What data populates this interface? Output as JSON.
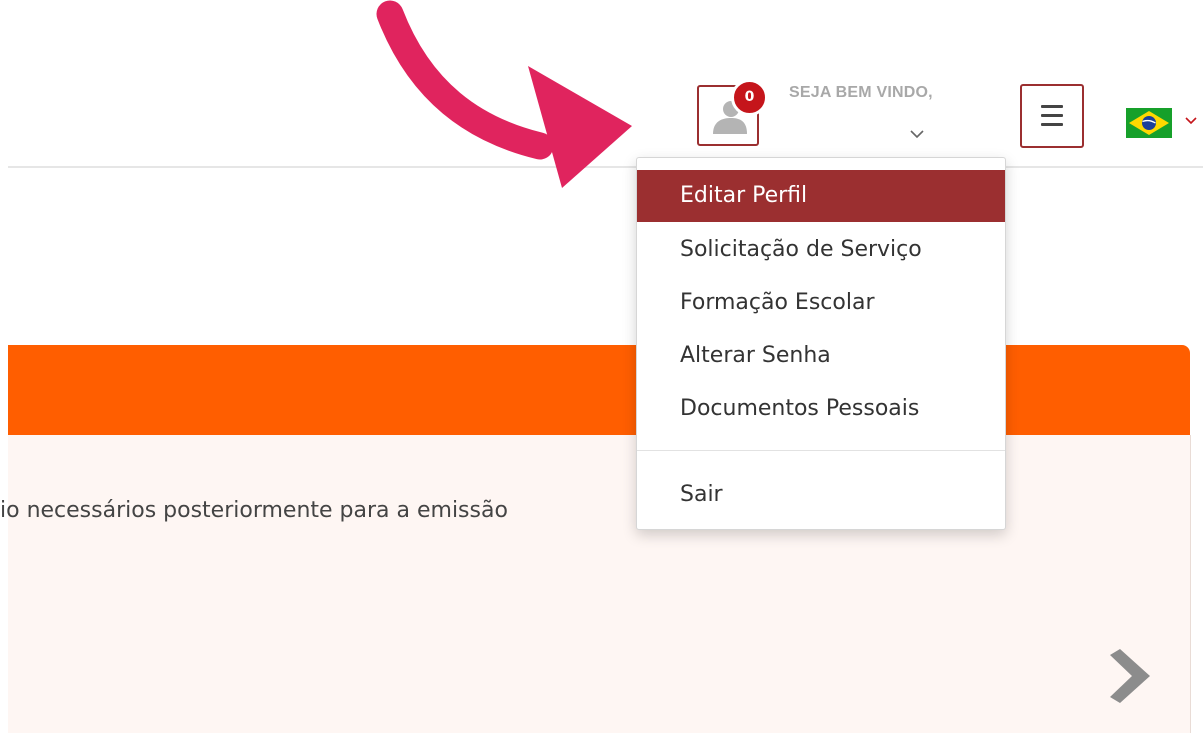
{
  "header": {
    "notification_count": "0",
    "welcome_text": "SEJA BEM VINDO,",
    "menu_icon": "hamburger-icon",
    "language_flag": "brazil-flag-icon"
  },
  "user_menu": {
    "items": [
      {
        "label": "Editar Perfil",
        "active": true
      },
      {
        "label": "Solicitação de Serviço",
        "active": false
      },
      {
        "label": "Formação Escolar",
        "active": false
      },
      {
        "label": "Alterar Senha",
        "active": false
      },
      {
        "label": "Documentos Pessoais",
        "active": false
      }
    ],
    "logout_label": "Sair"
  },
  "card": {
    "body_text": "io necessários posteriormente para a emissão"
  },
  "colors": {
    "brand_red": "#9b2f30",
    "badge_red": "#c5151b",
    "card_orange": "#ff5e00",
    "annotation_pink": "#e0245e"
  }
}
